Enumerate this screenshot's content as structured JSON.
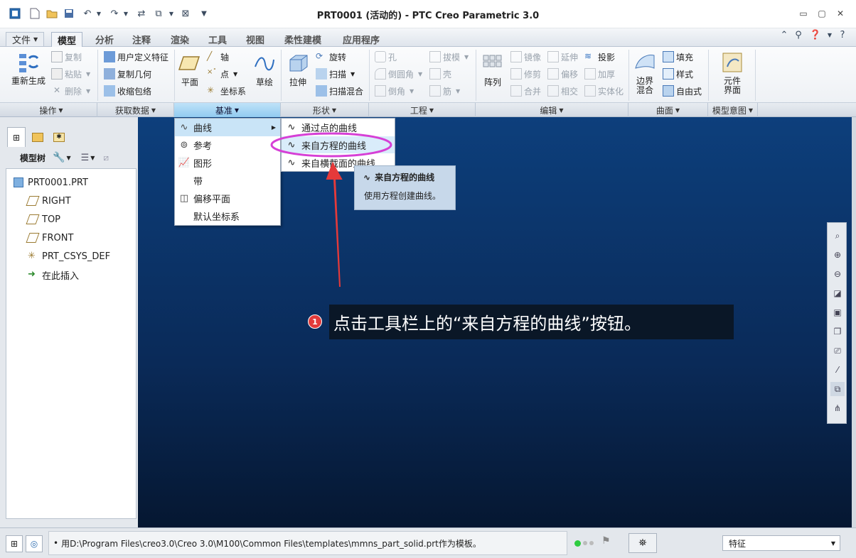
{
  "window": {
    "title": "PRT0001 (活动的) - PTC Creo Parametric 3.0",
    "controls": {
      "minimize": "▭",
      "maximize": "▢",
      "close": "✕"
    }
  },
  "tabs": {
    "file": "文件",
    "items": [
      "模型",
      "分析",
      "注释",
      "渲染",
      "工具",
      "视图",
      "柔性建模",
      "应用程序"
    ],
    "active": "模型"
  },
  "ribbon": {
    "regenerate": "重新生成",
    "copy": "复制",
    "paste": "粘贴",
    "delete": "删除",
    "user_feature": "用户定义特征",
    "copy_geometry": "复制几何",
    "shrinkwrap": "收缩包络",
    "plane": "平面",
    "axis": "轴",
    "point": "点",
    "csys": "坐标系",
    "sketch": "草绘",
    "extrude": "拉伸",
    "revolve": "旋转",
    "sweep": "扫描",
    "swept_blend": "扫描混合",
    "hole": "孔",
    "round": "倒圆角",
    "chamfer": "倒角",
    "draft": "拔模",
    "shell": "壳",
    "rib": "筋",
    "pattern": "阵列",
    "mirror": "镜像",
    "trim": "修剪",
    "merge": "合并",
    "extend": "延伸",
    "offset": "偏移",
    "intersect": "相交",
    "project": "投影",
    "thicken": "加厚",
    "solidify": "实体化",
    "boundary_blend_1": "边界",
    "boundary_blend_2": "混合",
    "fill": "填充",
    "style": "样式",
    "freestyle": "自由式",
    "component_interface_1": "元件",
    "component_interface_2": "界面"
  },
  "groups": [
    "操作",
    "获取数据",
    "基准",
    "形状",
    "工程",
    "编辑",
    "曲面",
    "模型意图"
  ],
  "active_group": "基准",
  "datum_menu": {
    "items": [
      "曲线",
      "参考",
      "图形",
      "带",
      "偏移平面",
      "默认坐标系"
    ],
    "submenu": [
      "通过点的曲线",
      "来自方程的曲线",
      "来自横截面的曲线"
    ]
  },
  "tooltip": {
    "title": "来自方程的曲线",
    "body": "使用方程创建曲线。"
  },
  "model_tree": {
    "header": "模型树",
    "items": [
      "PRT0001.PRT",
      "RIGHT",
      "TOP",
      "FRONT",
      "PRT_CSYS_DEF",
      "在此插入"
    ]
  },
  "callout": {
    "number": "1",
    "text": "点击工具栏上的“来自方程的曲线”按钮。"
  },
  "status": {
    "message": "用D:\\Program Files\\creo3.0\\Creo 3.0\\M100\\Common Files\\templates\\mmns_part_solid.prt作为模板。",
    "filter": "特征"
  },
  "colors": {
    "accent": "#8fcaf0",
    "highlight_ellipse": "#d63fd6",
    "arrow": "#e53a3a",
    "canvas_top": "#0d3f7c",
    "canvas_bottom": "#051731"
  }
}
